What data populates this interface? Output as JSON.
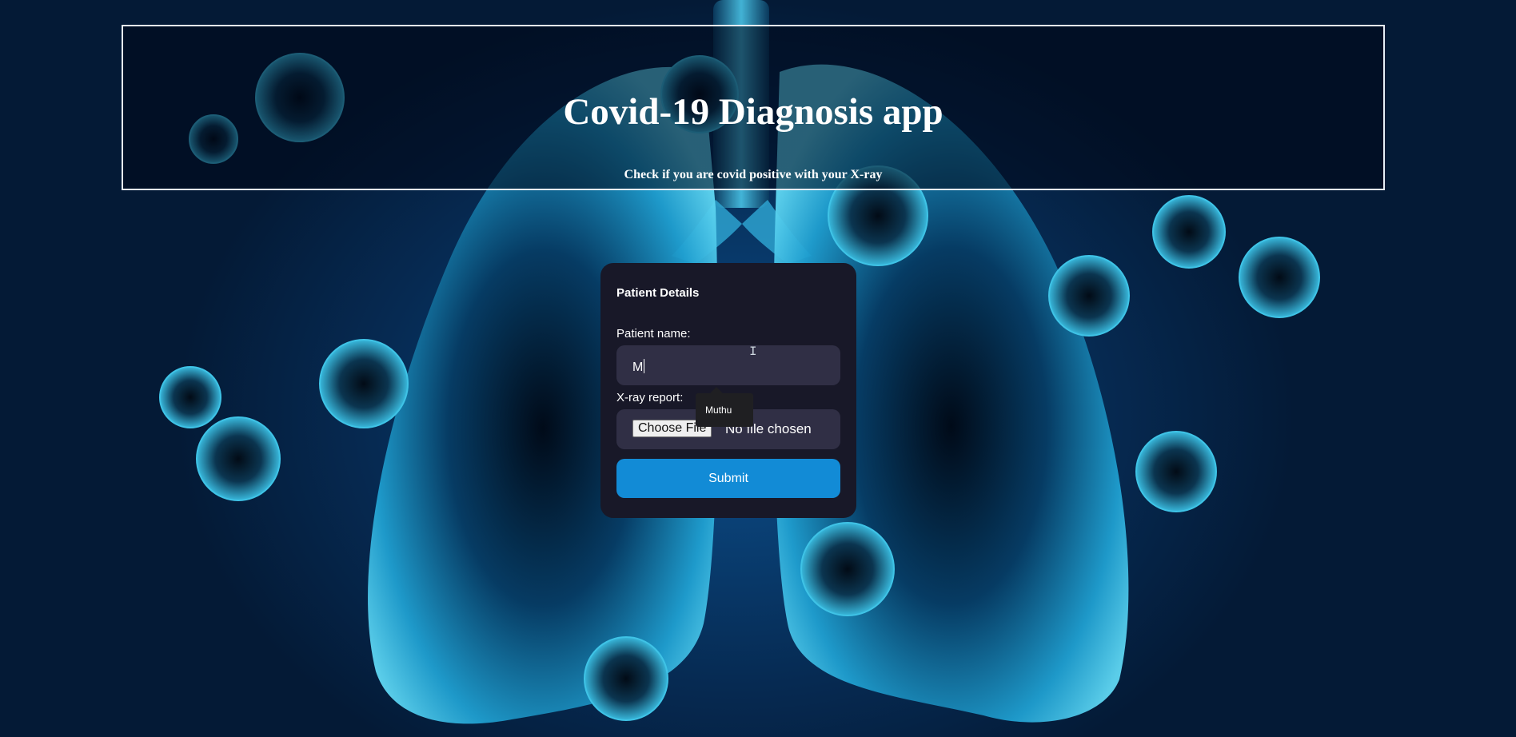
{
  "header": {
    "title": "Covid-19 Diagnosis app",
    "subtitle": "Check if you are covid positive with your X-ray"
  },
  "form": {
    "heading": "Patient Details",
    "name_label": "Patient name:",
    "name_value": "M",
    "xray_label": "X-ray report:",
    "choose_file_label": "Choose File",
    "file_status": "No file chosen",
    "submit_label": "Submit"
  },
  "autocomplete": {
    "suggestion": "Muthu"
  },
  "colors": {
    "accent": "#128bd6",
    "card_bg": "#181828",
    "field_bg": "#302f45"
  },
  "background": {
    "image": "lungs-with-virus-particles"
  }
}
